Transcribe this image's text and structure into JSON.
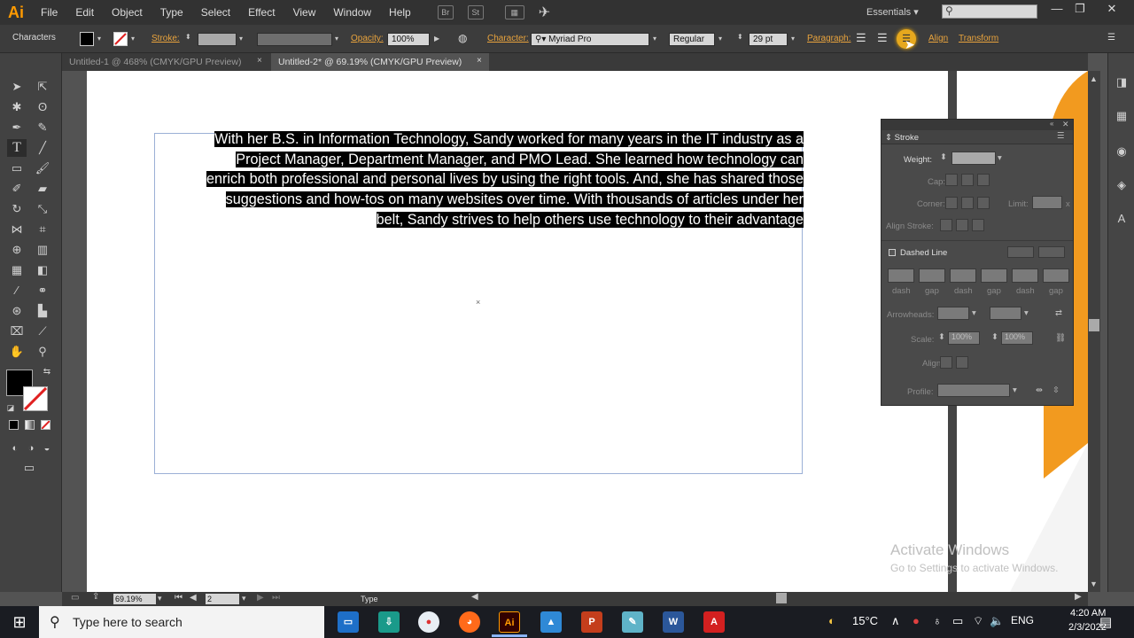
{
  "app": {
    "logo": "Ai",
    "workspace": "Essentials"
  },
  "menu": [
    "File",
    "Edit",
    "Object",
    "Type",
    "Select",
    "Effect",
    "View",
    "Window",
    "Help"
  ],
  "menu_icons": {
    "bridge": "Br",
    "stock": "St"
  },
  "control": {
    "panel_name": "Characters",
    "stroke_label": "Stroke:",
    "opacity_label": "Opacity:",
    "opacity_value": "100%",
    "character_label": "Character:",
    "font_family": "Myriad Pro",
    "font_style": "Regular",
    "font_size": "29 pt",
    "paragraph_label": "Paragraph:",
    "align_label": "Align",
    "transform_label": "Transform"
  },
  "tabs": [
    {
      "label": "Untitled-1 @ 468% (CMYK/GPU Preview)",
      "close": "×"
    },
    {
      "label": "Untitled-2* @ 69.19% (CMYK/GPU Preview)",
      "close": "×"
    }
  ],
  "document": {
    "lines": [
      "With her B.S. in Information Technology, Sandy worked for many years in the IT industry as a",
      "Project Manager, Department Manager, and PMO Lead. She learned how technology can",
      "enrich both professional and personal lives by using the right tools. And, she has shared those",
      "suggestions and how-tos on many websites over time. With thousands of articles under her",
      "belt, Sandy strives to help others use technology to their advantage"
    ],
    "center_mark": "×"
  },
  "stroke_panel": {
    "title": "Stroke",
    "weight_label": "Weight:",
    "cap_label": "Cap:",
    "corner_label": "Corner:",
    "limit_label": "Limit:",
    "limit_unit": "x",
    "align_label": "Align Stroke:",
    "dashed_label": "Dashed Line",
    "dash_labels": [
      "dash",
      "gap",
      "dash",
      "gap",
      "dash",
      "gap"
    ],
    "arrowheads_label": "Arrowheads:",
    "scale_label": "Scale:",
    "scale_1": "100%",
    "scale_2": "100%",
    "align_arrow_label": "Align:",
    "profile_label": "Profile:"
  },
  "status": {
    "zoom": "69.19%",
    "page": "2",
    "tool": "Type"
  },
  "watermark": {
    "line1": "Activate Windows",
    "line2": "Go to Settings to activate Windows."
  },
  "taskbar": {
    "search_placeholder": "Type here to search",
    "temperature": "15°C",
    "language": "ENG",
    "time": "4:20 AM",
    "date": "2/3/2022"
  },
  "colors": {
    "accent": "#ff9a00",
    "selection": "#000000",
    "artboard_border": "#9bb0d6",
    "orange_shape": "#f29a1f"
  }
}
